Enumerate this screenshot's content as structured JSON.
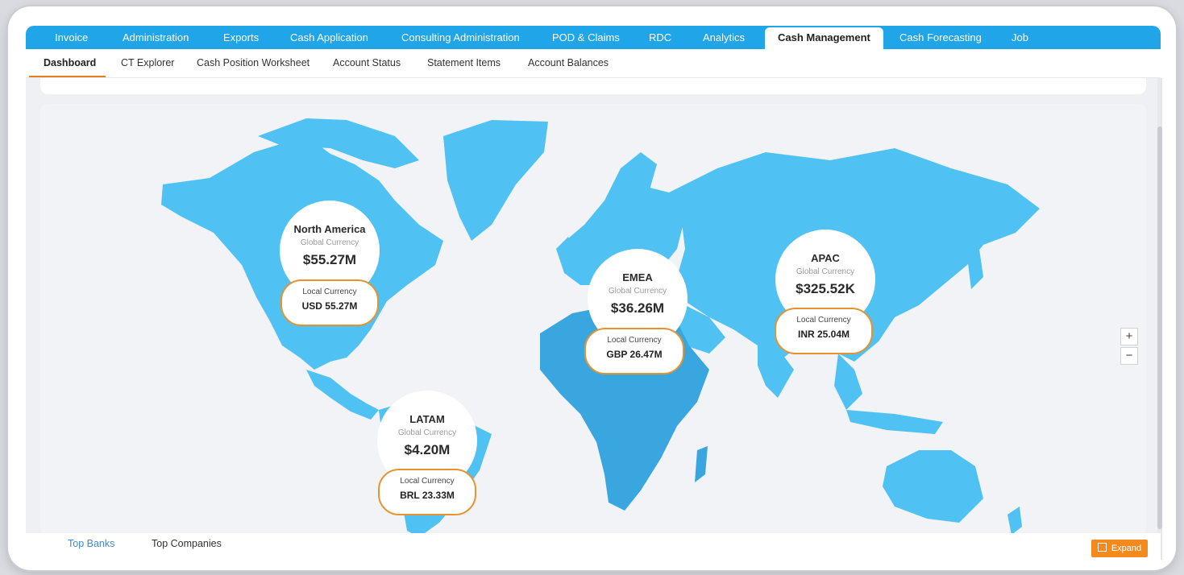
{
  "top_nav": {
    "tabs": [
      {
        "label": "Invoice"
      },
      {
        "label": "Administration"
      },
      {
        "label": "Exports"
      },
      {
        "label": "Cash Application"
      },
      {
        "label": "Consulting Administration"
      },
      {
        "label": "POD & Claims"
      },
      {
        "label": "RDC"
      },
      {
        "label": "Analytics"
      },
      {
        "label": "Cash Management",
        "active": true
      },
      {
        "label": "Cash Forecasting"
      },
      {
        "label": "Job"
      }
    ]
  },
  "sub_nav": {
    "tabs": [
      {
        "label": "Dashboard",
        "active": true
      },
      {
        "label": "CT Explorer"
      },
      {
        "label": "Cash Position Worksheet"
      },
      {
        "label": "Account Status"
      },
      {
        "label": "Statement Items"
      },
      {
        "label": "Account Balances"
      }
    ]
  },
  "map": {
    "regions": [
      {
        "name": "North America",
        "global_label": "Global Currency",
        "global_value": "$55.27M",
        "local_label": "Local Currency",
        "local_value": "USD 55.27M"
      },
      {
        "name": "EMEA",
        "global_label": "Global Currency",
        "global_value": "$36.26M",
        "local_label": "Local Currency",
        "local_value": "GBP 26.47M"
      },
      {
        "name": "APAC",
        "global_label": "Global Currency",
        "global_value": "$325.52K",
        "local_label": "Local Currency",
        "local_value": "INR 25.04M"
      },
      {
        "name": "LATAM",
        "global_label": "Global Currency",
        "global_value": "$4.20M",
        "local_label": "Local Currency",
        "local_value": "BRL 23.33M"
      }
    ],
    "zoom_in": "+",
    "zoom_out": "−",
    "land_color": "#4fc1f2",
    "africa_color": "#3aa6e0"
  },
  "bottom": {
    "tabs": [
      {
        "label": "Top Banks",
        "active": true
      },
      {
        "label": "Top Companies"
      }
    ],
    "expand_label": "Expand"
  }
}
